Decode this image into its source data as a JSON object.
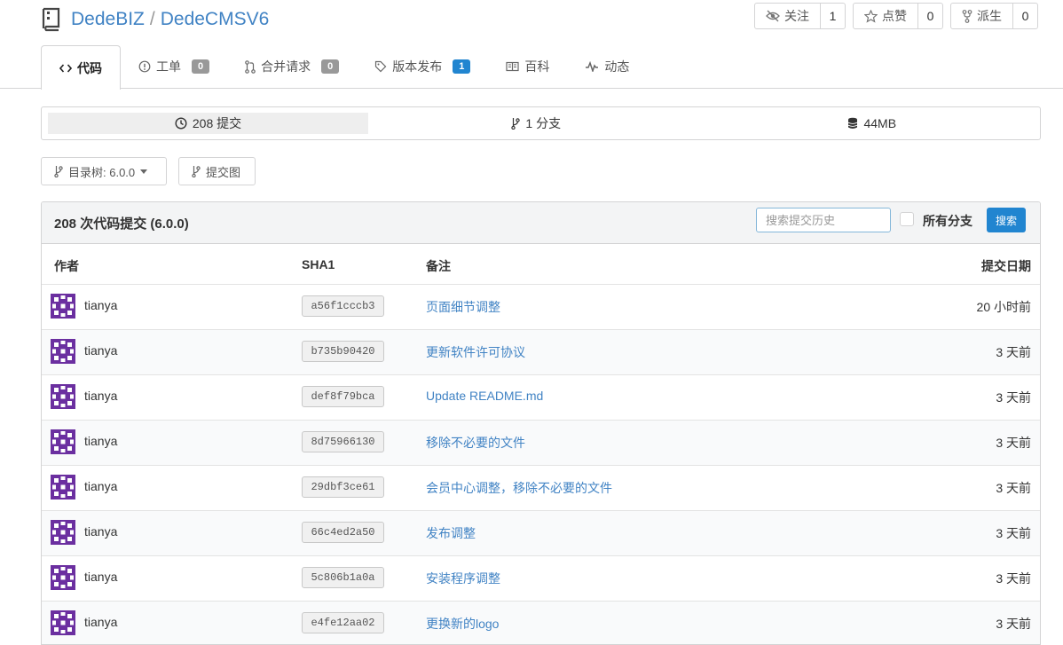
{
  "header": {
    "owner": "DedeBIZ",
    "separator": "/",
    "repo": "DedeCMSV6",
    "actions": [
      {
        "label": "关注",
        "count": "1",
        "icon": "eye-slash-icon"
      },
      {
        "label": "点赞",
        "count": "0",
        "icon": "star-icon"
      },
      {
        "label": "派生",
        "count": "0",
        "icon": "fork-icon"
      }
    ]
  },
  "tabs": [
    {
      "label": "代码",
      "icon": "code-icon",
      "active": true
    },
    {
      "label": "工单",
      "icon": "issue-icon",
      "badge": "0"
    },
    {
      "label": "合并请求",
      "icon": "pull-request-icon",
      "badge": "0"
    },
    {
      "label": "版本发布",
      "icon": "tag-icon",
      "badge": "1"
    },
    {
      "label": "百科",
      "icon": "book-icon"
    },
    {
      "label": "动态",
      "icon": "pulse-icon"
    }
  ],
  "stats": {
    "commits": "208 提交",
    "branches": "1 分支",
    "size": "44MB"
  },
  "branch_selector": "目录树: 6.0.0",
  "graph_button": "提交图",
  "commits_panel": {
    "title": "208 次代码提交 (6.0.0)",
    "search_placeholder": "搜索提交历史",
    "all_branches_label": "所有分支",
    "search_button": "搜索",
    "columns": {
      "author": "作者",
      "sha": "SHA1",
      "message": "备注",
      "date": "提交日期"
    },
    "rows": [
      {
        "author": "tianya",
        "sha": "a56f1cccb3",
        "message": "页面细节调整",
        "date": "20 小时前"
      },
      {
        "author": "tianya",
        "sha": "b735b90420",
        "message": "更新软件许可协议",
        "date": "3 天前"
      },
      {
        "author": "tianya",
        "sha": "def8f79bca",
        "message": "Update README.md",
        "date": "3 天前"
      },
      {
        "author": "tianya",
        "sha": "8d75966130",
        "message": "移除不必要的文件",
        "date": "3 天前"
      },
      {
        "author": "tianya",
        "sha": "29dbf3ce61",
        "message": "会员中心调整，移除不必要的文件",
        "date": "3 天前"
      },
      {
        "author": "tianya",
        "sha": "66c4ed2a50",
        "message": "发布调整",
        "date": "3 天前"
      },
      {
        "author": "tianya",
        "sha": "5c806b1a0a",
        "message": "安装程序调整",
        "date": "3 天前"
      },
      {
        "author": "tianya",
        "sha": "e4fe12aa02",
        "message": "更换新的logo",
        "date": "3 天前"
      }
    ]
  },
  "colors": {
    "link": "#4183c4",
    "primary": "#2185d0",
    "avatar": "#6b2fa0"
  }
}
